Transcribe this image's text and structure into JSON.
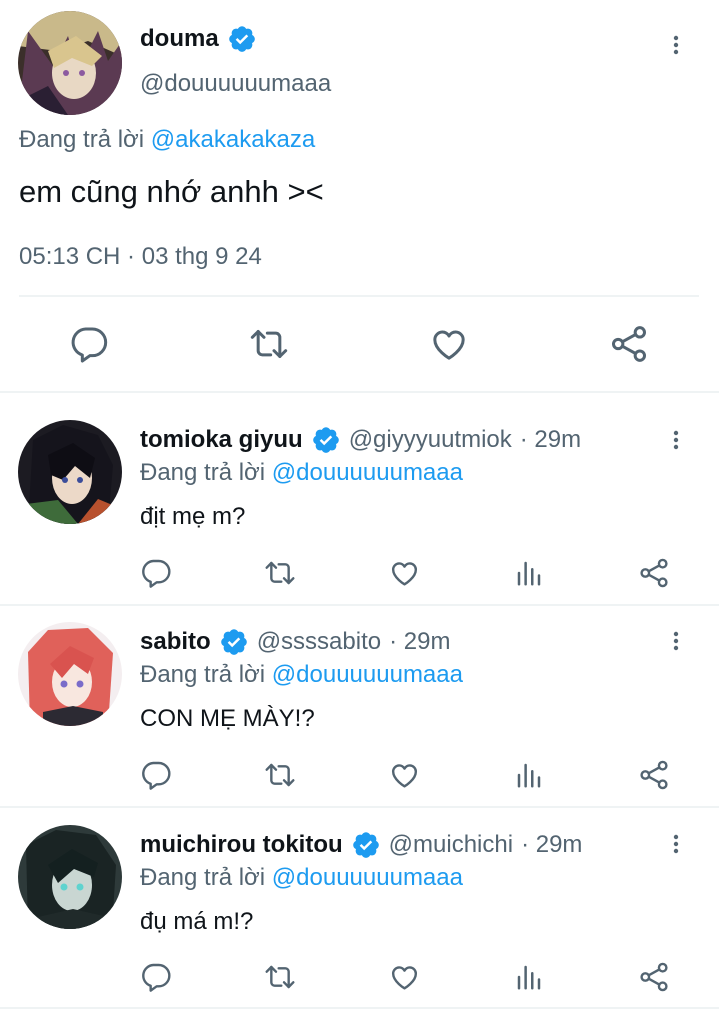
{
  "main_tweet": {
    "name": "douma",
    "handle": "@douuuuuumaaa",
    "replying_prefix": "Đang trả lời",
    "replying_to": "@akakakakaza",
    "text": "em cũng nhớ anhh ><",
    "timestamp": "05:13 CH · 03 thg 9 24"
  },
  "replies": [
    {
      "name": "tomioka giyuu",
      "handle": "@giyyyuutmiok",
      "time": "· 29m",
      "replying_prefix": "Đang trả lời",
      "replying_to": "@douuuuuumaaa",
      "text": "địt mẹ m?"
    },
    {
      "name": "sabito",
      "handle": "@ssssabito",
      "time": "· 29m",
      "replying_prefix": "Đang trả lời",
      "replying_to": "@douuuuuumaaa",
      "text": "CON MẸ MÀY!?"
    },
    {
      "name": "muichirou tokitou",
      "handle": "@muichichi",
      "time": "· 29m",
      "replying_prefix": "Đang trả lời",
      "replying_to": "@douuuuuumaaa",
      "text": "đụ má m!?"
    }
  ],
  "colors": {
    "accent": "#1d9bf0",
    "text": "#0f1419",
    "muted": "#536471",
    "divider": "#eff3f4"
  },
  "icons": {
    "reply": "reply-icon",
    "retweet": "retweet-icon",
    "like": "heart-icon",
    "views": "views-icon",
    "share": "share-icon",
    "more": "more-vertical-icon",
    "verified": "verified-icon"
  }
}
